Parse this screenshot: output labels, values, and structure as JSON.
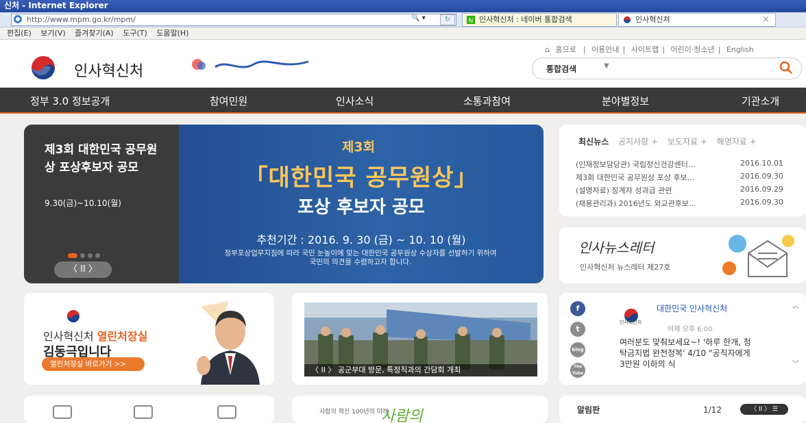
{
  "browser": {
    "title": "신처 - Internet Explorer",
    "url": "http://www.mpm.go.kr/mpm/",
    "tabs": [
      {
        "label": "인사혁신처 : 네이버 통합검색"
      },
      {
        "label": "인사혁신처"
      }
    ],
    "menu": [
      "편집(E)",
      "보기(V)",
      "즐겨찾기(A)",
      "도구(T)",
      "도움말(H)"
    ]
  },
  "header": {
    "site_name": "인사혁신처",
    "top_links": [
      "홈으로",
      "이용안내",
      "사이트맵",
      "어린이·청소년",
      "English"
    ],
    "search_scope": "통합검색"
  },
  "gnb": [
    "정부 3.0 정보공개",
    "참여민원",
    "인사소식",
    "소통과참여",
    "분야별정보",
    "기관소개"
  ],
  "hero": {
    "title": "제3회 대한민국 공무원상 포상후보자 공모",
    "date": "9.30(금)~10.10(월)",
    "round": "제3회",
    "main": "「대한민국 공무원상」",
    "sub": "포상 후보자 공모",
    "period": "추천기간 : 2016. 9. 30 (금) ~ 10. 10 (월)",
    "desc": "정부포상업무지침에 따라 국민 눈높이에 맞는 대한민국 공무원상 수상자를 선발하기 위하여 국민의 의견을 수렴하고자 합니다.",
    "controls": "〈 II 〉"
  },
  "news": {
    "tabs": [
      "최신뉴스",
      "공지사항 +",
      "보도자료 +",
      "해명자료 +"
    ],
    "items": [
      {
        "title": "(인재정보담당관) 국립정신건강센터…",
        "date": "2016.10.01"
      },
      {
        "title": "제3회 대한민국 공무원상 포상 후보…",
        "date": "2016.09.30"
      },
      {
        "title": "(설명자료) 징계자 성과급 관련",
        "date": "2016.09.29"
      },
      {
        "title": "(채용관리과) 2016년도 외교관후보…",
        "date": "2016.09.30"
      }
    ]
  },
  "newsletter": {
    "title": "인사뉴스레터",
    "subtitle": "인사혁신처 뉴스레터 제27호"
  },
  "minister": {
    "line1_prefix": "인사혁신처 ",
    "line1_highlight": "열린처장실",
    "line2": "김동극입니다",
    "button": "열린처장실 바로가기 >>"
  },
  "photo": {
    "caption": "〈  II  〉  공군부대 방문, 특정직과의 간담회 개최"
  },
  "sns": {
    "icons": [
      "f",
      "t",
      "blog",
      "You Tube"
    ],
    "account": "대한민국 인사혁신처",
    "logo_text": "인사혁신처",
    "time": "어제 오후 6:00",
    "text": "여러분도 맞춰보세요~! '하루 한개, 청탁금지법 완전정복' 4/10 \"공직자에게 3만원 이하의 식"
  },
  "notice": {
    "label": "알림판",
    "page": "1/12",
    "controls": "〈 II 〉 ☰"
  },
  "bookbanner": {
    "small": "사람의 혁신 100년의 미래",
    "big": "사람의"
  },
  "colors": {
    "accent": "#e5621f",
    "gnb_bg": "#3a3a3a",
    "hero_blue": "#2b5a98",
    "hero_gold": "#fbc65a"
  }
}
